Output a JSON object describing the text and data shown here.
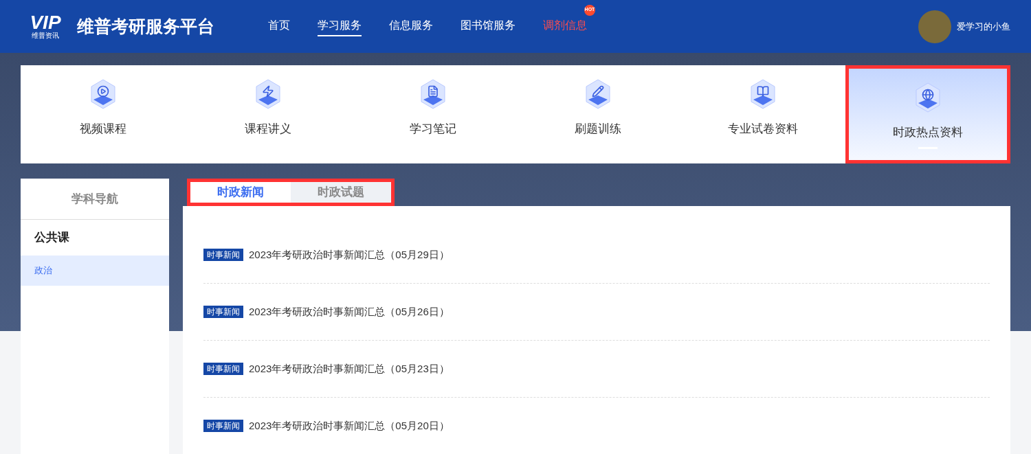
{
  "header": {
    "logo_mark": "VIP",
    "logo_sub": "维普资讯",
    "site_title": "维普考研服务平台",
    "nav": [
      {
        "label": "首页",
        "selected": false,
        "hot": false
      },
      {
        "label": "学习服务",
        "selected": true,
        "hot": false
      },
      {
        "label": "信息服务",
        "selected": false,
        "hot": false
      },
      {
        "label": "图书馆服务",
        "selected": false,
        "hot": false
      },
      {
        "label": "调剂信息",
        "selected": false,
        "hot": true,
        "badge": "HOT"
      }
    ],
    "user": {
      "name": "爱学习的小鱼"
    }
  },
  "categories": [
    {
      "label": "视频课程",
      "kind": "video",
      "selected": false
    },
    {
      "label": "课程讲义",
      "kind": "lecture",
      "selected": false
    },
    {
      "label": "学习笔记",
      "kind": "notes",
      "selected": false
    },
    {
      "label": "刷题训练",
      "kind": "practice",
      "selected": false
    },
    {
      "label": "专业试卷资料",
      "kind": "papers",
      "selected": false
    },
    {
      "label": "时政热点资料",
      "kind": "news",
      "selected": true
    }
  ],
  "sidebar": {
    "title": "学科导航",
    "group": "公共课",
    "items": [
      {
        "label": "政治",
        "selected": true
      }
    ]
  },
  "tabs": [
    {
      "label": "时政新闻",
      "selected": true
    },
    {
      "label": "时政试题",
      "selected": false
    }
  ],
  "articles": [
    {
      "tag": "时事新闻",
      "title": "2023年考研政治时事新闻汇总（05月29日）"
    },
    {
      "tag": "时事新闻",
      "title": "2023年考研政治时事新闻汇总（05月26日）"
    },
    {
      "tag": "时事新闻",
      "title": "2023年考研政治时事新闻汇总（05月23日）"
    },
    {
      "tag": "时事新闻",
      "title": "2023年考研政治时事新闻汇总（05月20日）"
    }
  ]
}
